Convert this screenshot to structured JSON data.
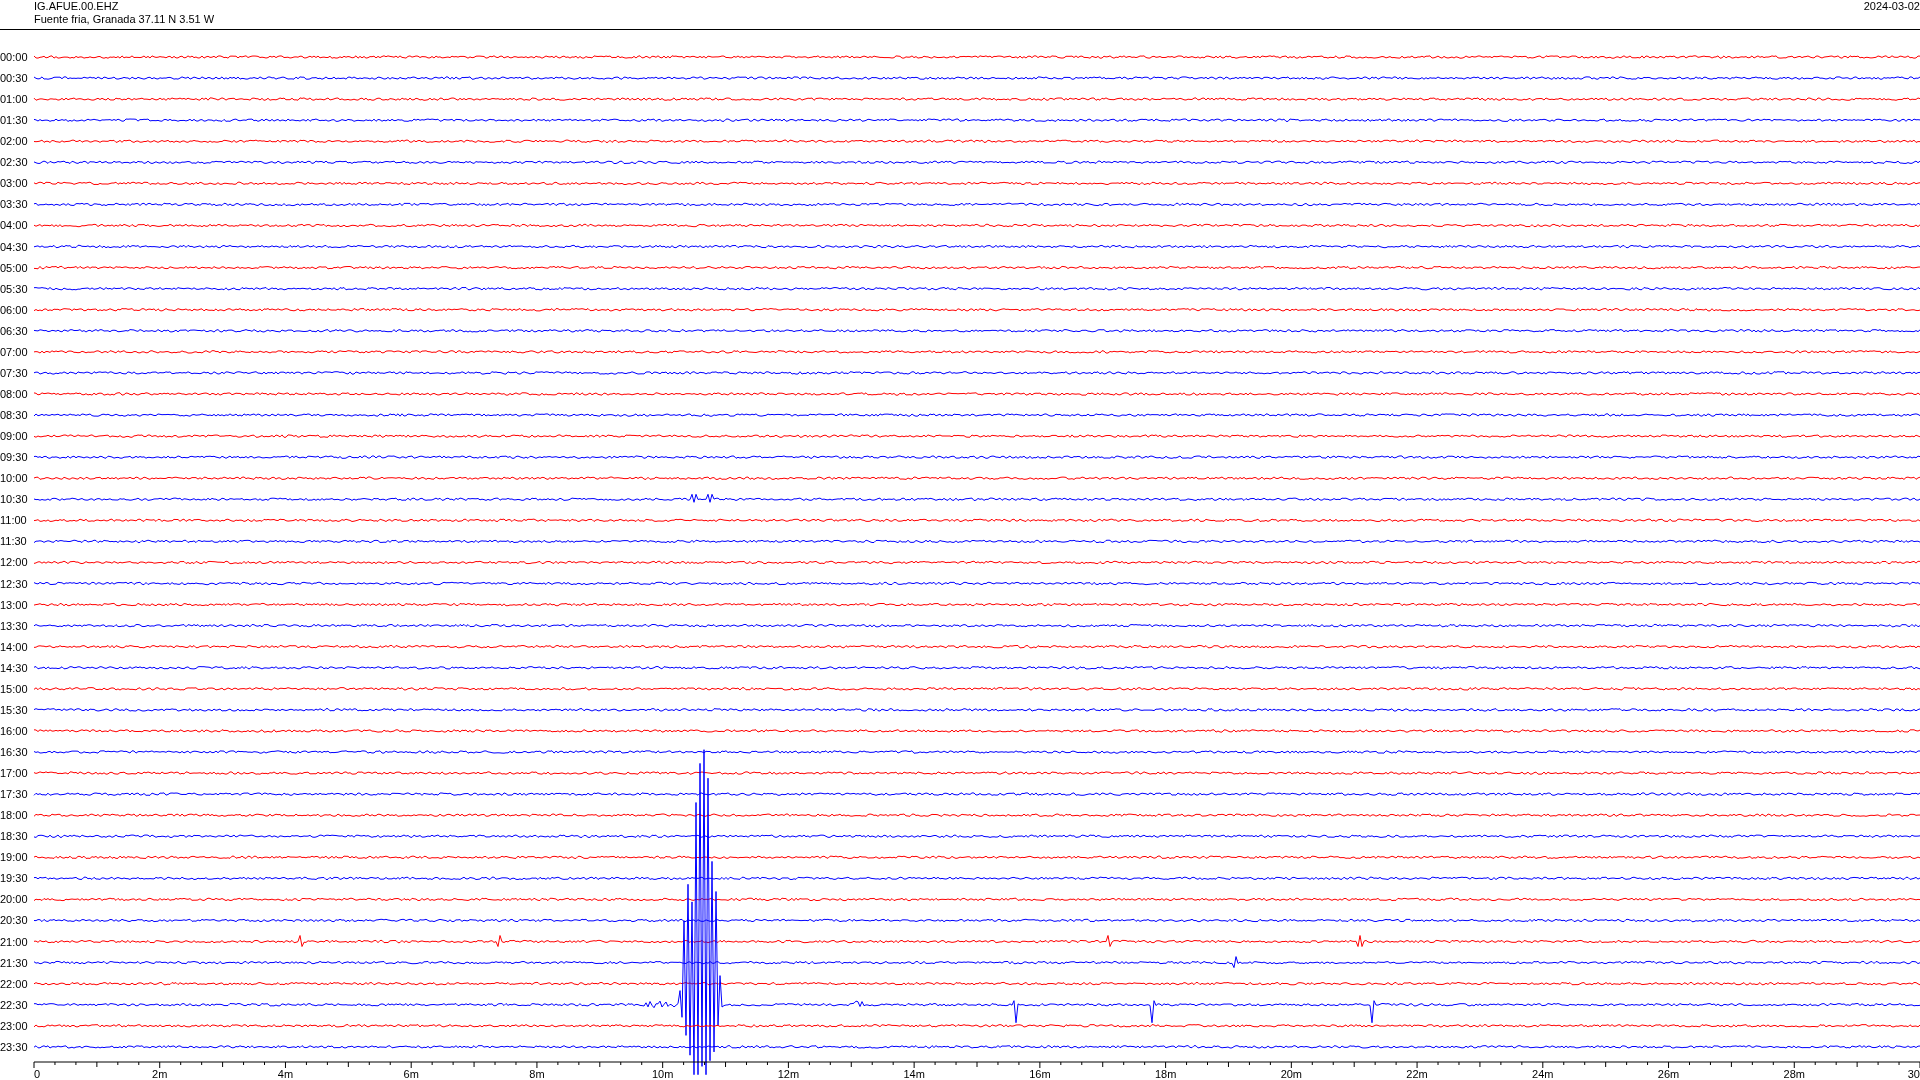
{
  "header": {
    "station": "IG.AFUE.00.EHZ",
    "location": "Fuente fria, Granada  37.11 N 3.51 W",
    "date": "2024-03-02"
  },
  "rows": [
    {
      "label": "00:00",
      "color": "#ff0000"
    },
    {
      "label": "00:30",
      "color": "#0000ff"
    },
    {
      "label": "01:00",
      "color": "#ff0000"
    },
    {
      "label": "01:30",
      "color": "#0000ff"
    },
    {
      "label": "02:00",
      "color": "#ff0000"
    },
    {
      "label": "02:30",
      "color": "#0000ff"
    },
    {
      "label": "03:00",
      "color": "#ff0000"
    },
    {
      "label": "03:30",
      "color": "#0000ff"
    },
    {
      "label": "04:00",
      "color": "#ff0000"
    },
    {
      "label": "04:30",
      "color": "#0000ff"
    },
    {
      "label": "05:00",
      "color": "#ff0000"
    },
    {
      "label": "05:30",
      "color": "#0000ff"
    },
    {
      "label": "06:00",
      "color": "#ff0000"
    },
    {
      "label": "06:30",
      "color": "#0000ff"
    },
    {
      "label": "07:00",
      "color": "#ff0000"
    },
    {
      "label": "07:30",
      "color": "#0000ff"
    },
    {
      "label": "08:00",
      "color": "#ff0000"
    },
    {
      "label": "08:30",
      "color": "#0000ff"
    },
    {
      "label": "09:00",
      "color": "#ff0000"
    },
    {
      "label": "09:30",
      "color": "#0000ff"
    },
    {
      "label": "10:00",
      "color": "#ff0000"
    },
    {
      "label": "10:30",
      "color": "#0000ff"
    },
    {
      "label": "11:00",
      "color": "#ff0000"
    },
    {
      "label": "11:30",
      "color": "#0000ff"
    },
    {
      "label": "12:00",
      "color": "#ff0000"
    },
    {
      "label": "12:30",
      "color": "#0000ff"
    },
    {
      "label": "13:00",
      "color": "#ff0000"
    },
    {
      "label": "13:30",
      "color": "#0000ff"
    },
    {
      "label": "14:00",
      "color": "#ff0000"
    },
    {
      "label": "14:30",
      "color": "#0000ff"
    },
    {
      "label": "15:00",
      "color": "#ff0000"
    },
    {
      "label": "15:30",
      "color": "#0000ff"
    },
    {
      "label": "16:00",
      "color": "#ff0000"
    },
    {
      "label": "16:30",
      "color": "#0000ff"
    },
    {
      "label": "17:00",
      "color": "#ff0000"
    },
    {
      "label": "17:30",
      "color": "#0000ff"
    },
    {
      "label": "18:00",
      "color": "#ff0000"
    },
    {
      "label": "18:30",
      "color": "#0000ff"
    },
    {
      "label": "19:00",
      "color": "#ff0000"
    },
    {
      "label": "19:30",
      "color": "#0000ff"
    },
    {
      "label": "20:00",
      "color": "#ff0000"
    },
    {
      "label": "20:30",
      "color": "#0000ff"
    },
    {
      "label": "21:00",
      "color": "#ff0000"
    },
    {
      "label": "21:30",
      "color": "#0000ff"
    },
    {
      "label": "22:00",
      "color": "#ff0000"
    },
    {
      "label": "22:30",
      "color": "#0000ff"
    },
    {
      "label": "23:00",
      "color": "#ff0000"
    },
    {
      "label": "23:30",
      "color": "#0000ff"
    }
  ],
  "x_axis": {
    "ticks": [
      "0",
      "2m",
      "4m",
      "6m",
      "8m",
      "10m",
      "12m",
      "14m",
      "16m",
      "18m",
      "20m",
      "22m",
      "24m",
      "26m",
      "28m",
      "30"
    ]
  }
}
